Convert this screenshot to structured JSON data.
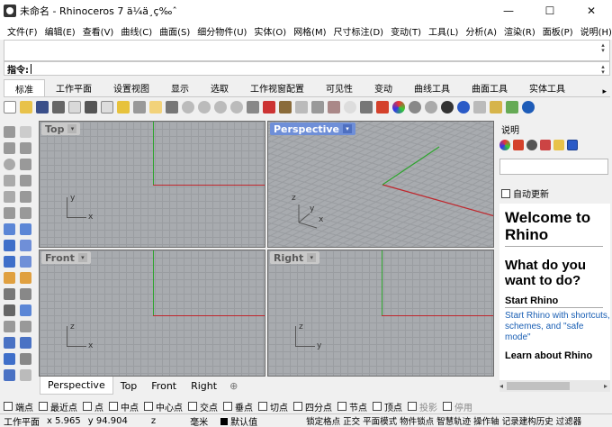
{
  "window": {
    "title": "未命名 - Rhinoceros 7 ä¼ä¸ç‰ˆ",
    "minimize": "—",
    "maximize": "☐",
    "close": "✕"
  },
  "menu": [
    "文件(F)",
    "编辑(E)",
    "查看(V)",
    "曲线(C)",
    "曲面(S)",
    "细分物件(U)",
    "实体(O)",
    "网格(M)",
    "尺寸标注(D)",
    "变动(T)",
    "工具(L)",
    "分析(A)",
    "渲染(R)",
    "面板(P)",
    "说明(H)"
  ],
  "command": {
    "label": "指令:",
    "value": ""
  },
  "tabs": [
    "标准",
    "工作平面",
    "设置视图",
    "显示",
    "选取",
    "工作视窗配置",
    "可见性",
    "变动",
    "曲线工具",
    "曲面工具",
    "实体工具"
  ],
  "tabs_more": "▸",
  "viewports": {
    "top": {
      "label": "Top",
      "x": "x",
      "y": "y"
    },
    "perspective": {
      "label": "Perspective",
      "x": "x",
      "y": "y",
      "z": "z"
    },
    "front": {
      "label": "Front",
      "x": "x",
      "z": "z"
    },
    "right": {
      "label": "Right",
      "y": "y",
      "z": "z"
    },
    "dropdown_arrow": "▾"
  },
  "viewport_tabs": [
    "Perspective",
    "Top",
    "Front",
    "Right"
  ],
  "viewport_tabs_add": "⊕",
  "panel": {
    "title": "说明",
    "auto_update": "自动更新",
    "welcome_title": "Welcome to Rhino",
    "question": "What do you want to do?",
    "section1": "Start Rhino",
    "link1": "Start Rhino with shortcuts, schemes, and \"safe mode\"",
    "section2": "Learn about Rhino",
    "scroll_left": "◂",
    "scroll_right": "▸"
  },
  "osnaps": [
    {
      "label": "端点",
      "enabled": true
    },
    {
      "label": "最近点",
      "enabled": true
    },
    {
      "label": "点",
      "enabled": true
    },
    {
      "label": "中点",
      "enabled": true
    },
    {
      "label": "中心点",
      "enabled": true
    },
    {
      "label": "交点",
      "enabled": true
    },
    {
      "label": "垂点",
      "enabled": true
    },
    {
      "label": "切点",
      "enabled": true
    },
    {
      "label": "四分点",
      "enabled": true
    },
    {
      "label": "节点",
      "enabled": true
    },
    {
      "label": "顶点",
      "enabled": true
    },
    {
      "label": "投影",
      "enabled": false
    },
    {
      "label": "停用",
      "enabled": false
    }
  ],
  "status": {
    "cplane": "工作平面",
    "x": "x 5.965",
    "y": "y 94.904",
    "z": "z",
    "units": "毫米",
    "layer": "默认值",
    "modes": "锁定格点 正交 平面模式 物件锁点 智慧轨迹 操作轴 记录建构历史 过滤器"
  },
  "colors": {
    "axis_x": "#c0262c",
    "axis_y": "#2ea52e",
    "active_viewport": "#6f8fd8",
    "grid_bg": "#a8abaf",
    "link": "#1a5fb4"
  }
}
